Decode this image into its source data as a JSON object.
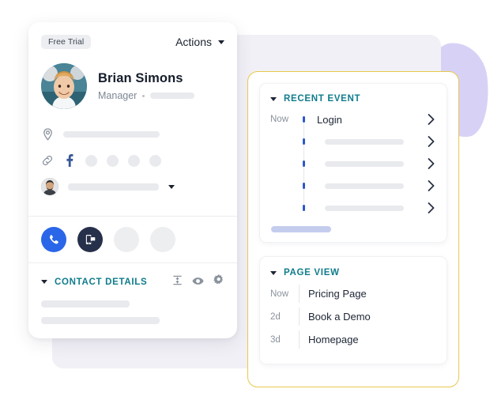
{
  "background": {
    "blob_color": "#d7d2f5",
    "backdrop_color": "#f1f0f6"
  },
  "theme": {
    "teal": "#0f7c8c",
    "accent_yellow": "#e8c84c",
    "blue": "#2a66e8",
    "navy": "#27304a",
    "timeline_dot": "#2d57c9",
    "periwinkle_bar": "#c5cdee"
  },
  "left_card": {
    "badge": "Free Trial",
    "actions_label": "Actions",
    "person": {
      "name": "Brian Simons",
      "role": "Manager",
      "avatar": "person-photo-avatar"
    },
    "info_rows": [
      {
        "icon": "location-pin-icon",
        "value": ""
      },
      {
        "icon": "link-icon",
        "value": ""
      },
      {
        "icon": "owner-avatar",
        "value": ""
      }
    ],
    "social_icons": [
      "facebook-icon",
      "social-placeholder-1",
      "social-placeholder-2",
      "social-placeholder-3",
      "social-placeholder-4"
    ],
    "action_buttons": [
      {
        "name": "call-button",
        "icon": "phone-icon",
        "style": "blue"
      },
      {
        "name": "sms-button",
        "icon": "sms-chat-icon",
        "style": "navy"
      },
      {
        "name": "action-placeholder-3",
        "icon": "",
        "style": "ghost"
      },
      {
        "name": "action-placeholder-4",
        "icon": "",
        "style": "ghost"
      }
    ],
    "contact_details": {
      "title": "CONTACT DETAILS",
      "tools": [
        "collapse-icon",
        "eye-icon",
        "gear-icon"
      ]
    }
  },
  "right_card": {
    "recent_event": {
      "title": "RECENT EVENT",
      "rows": [
        {
          "time": "Now",
          "label": "Login",
          "placeholder": false
        },
        {
          "time": "",
          "label": "",
          "placeholder": true
        },
        {
          "time": "",
          "label": "",
          "placeholder": true
        },
        {
          "time": "",
          "label": "",
          "placeholder": true
        },
        {
          "time": "",
          "label": "",
          "placeholder": true
        }
      ]
    },
    "page_view": {
      "title": "PAGE VIEW",
      "rows": [
        {
          "time": "Now",
          "label": "Pricing Page"
        },
        {
          "time": "2d",
          "label": "Book a Demo"
        },
        {
          "time": "3d",
          "label": "Homepage"
        }
      ]
    }
  }
}
